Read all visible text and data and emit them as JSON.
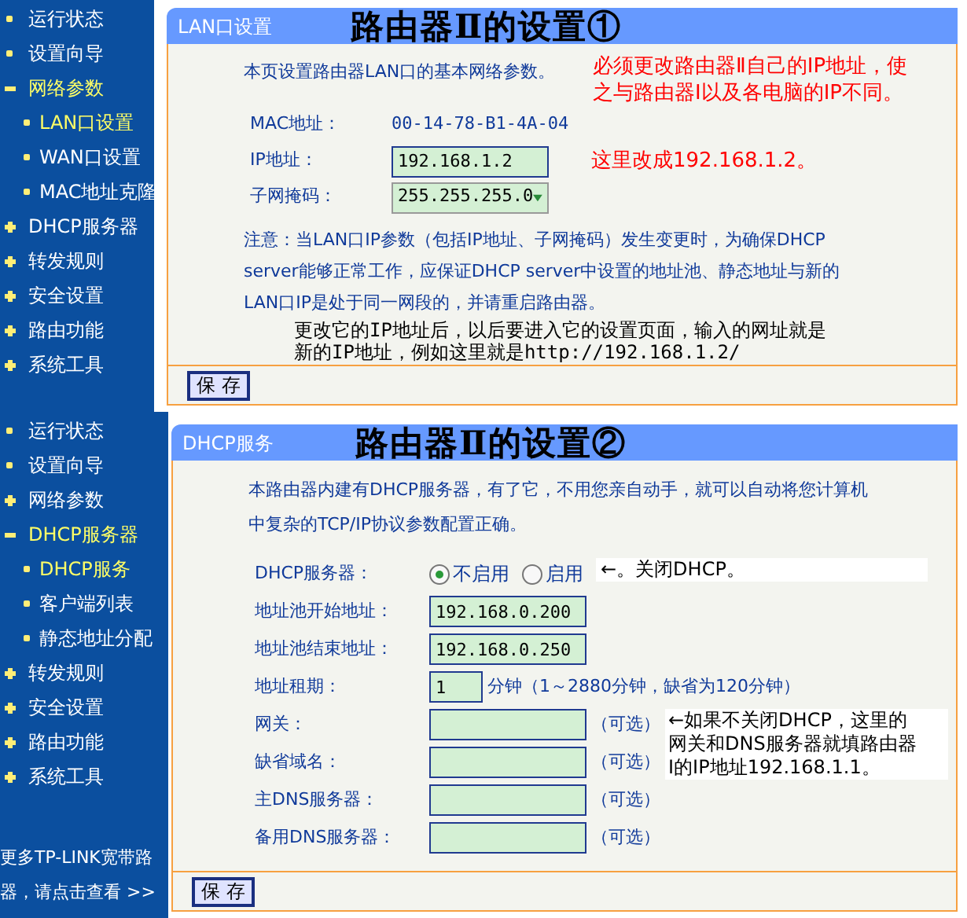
{
  "screens": [
    {
      "sidebar": {
        "items": [
          {
            "kind": "link",
            "label": "运行状态"
          },
          {
            "kind": "link",
            "label": "设置向导"
          },
          {
            "kind": "group",
            "label": "网络参数",
            "expanded": true,
            "children": [
              {
                "label": "LAN口设置",
                "selected": true
              },
              {
                "label": "WAN口设置",
                "selected": false
              },
              {
                "label": "MAC地址克隆",
                "selected": false
              }
            ]
          },
          {
            "kind": "group",
            "label": "DHCP服务器",
            "expanded": false
          },
          {
            "kind": "group",
            "label": "转发规则",
            "expanded": false
          },
          {
            "kind": "group",
            "label": "安全设置",
            "expanded": false
          },
          {
            "kind": "group",
            "label": "路由功能",
            "expanded": false
          },
          {
            "kind": "group",
            "label": "系统工具",
            "expanded": false
          }
        ]
      },
      "panel": {
        "header": "LAN口设置",
        "title": "路由器Ⅱ的设置①",
        "intro": "本页设置路由器LAN口的基本网络参数。",
        "intro_note": {
          "kind": "warning",
          "lines": [
            "必须更改路由器Ⅱ自己的IP地址，使",
            "之与路由器Ⅰ以及各电脑的IP不同。"
          ]
        },
        "fields": [
          {
            "kind": "static",
            "label": "MAC地址：",
            "value": "00-14-78-B1-4A-04"
          },
          {
            "kind": "text",
            "label": "IP地址：",
            "value": "192.168.1.2",
            "note": {
              "kind": "warning",
              "lines": [
                "这里改成192.168.1.2。"
              ]
            }
          },
          {
            "kind": "select",
            "label": "子网掩码：",
            "value": "255.255.255.0"
          }
        ],
        "caution": "注意：当LAN口IP参数（包括IP地址、子网掩码）发生变更时，为确保DHCP server能够正常工作，应保证DHCP server中设置的地址池、静态地址与新的LAN口IP是处于同一网段的，并请重启路由器。",
        "footnote": {
          "kind": "plain",
          "lines": [
            "更改它的IP地址后，以后要进入它的设置页面，输入的网址就是",
            "新的IP地址，例如这里就是http://192.168.1.2/"
          ]
        },
        "save_button": "保 存"
      }
    },
    {
      "sidebar": {
        "items": [
          {
            "kind": "link",
            "label": "运行状态"
          },
          {
            "kind": "link",
            "label": "设置向导"
          },
          {
            "kind": "group",
            "label": "网络参数",
            "expanded": false
          },
          {
            "kind": "group",
            "label": "DHCP服务器",
            "expanded": true,
            "children": [
              {
                "label": "DHCP服务",
                "selected": true
              },
              {
                "label": "客户端列表",
                "selected": false
              },
              {
                "label": "静态地址分配",
                "selected": false
              }
            ]
          },
          {
            "kind": "group",
            "label": "转发规则",
            "expanded": false
          },
          {
            "kind": "group",
            "label": "安全设置",
            "expanded": false
          },
          {
            "kind": "group",
            "label": "路由功能",
            "expanded": false
          },
          {
            "kind": "group",
            "label": "系统工具",
            "expanded": false
          }
        ],
        "more_link": [
          "更多TP-LINK宽带路",
          "器，请点击查看 >>"
        ]
      },
      "panel": {
        "header": "DHCP服务",
        "title": "路由器Ⅱ的设置②",
        "intro": "本路由器内建有DHCP服务器，有了它，不用您亲自动手，就可以自动将您计算机中复杂的TCP/IP协议参数配置正确。",
        "fields": [
          {
            "kind": "radio",
            "label": "DHCP服务器：",
            "options": [
              {
                "label": "不启用",
                "selected": true
              },
              {
                "label": "启用",
                "selected": false
              }
            ],
            "note": {
              "kind": "boxed",
              "lines": [
                "←。关闭DHCP。"
              ]
            }
          },
          {
            "kind": "text",
            "label": "地址池开始地址：",
            "value": "192.168.0.200"
          },
          {
            "kind": "text",
            "label": "地址池结束地址：",
            "value": "192.168.0.250"
          },
          {
            "kind": "short",
            "label": "地址租期：",
            "value": "1",
            "suffix": "分钟（1～2880分钟，缺省为120分钟）"
          },
          {
            "kind": "text",
            "label": "网关：",
            "suffix": "（可选）",
            "note": {
              "kind": "boxed",
              "lines": [
                "←如果不关闭DHCP，这里的",
                "网关和DNS服务器就填路由器",
                "Ⅰ的IP地址192.168.1.1。"
              ]
            }
          },
          {
            "kind": "text",
            "label": "缺省域名：",
            "suffix": "（可选）"
          },
          {
            "kind": "text",
            "label": "主DNS服务器：",
            "suffix": "（可选）"
          },
          {
            "kind": "text",
            "label": "备用DNS服务器：",
            "suffix": "（可选）"
          }
        ],
        "save_button": "保 存"
      }
    }
  ]
}
